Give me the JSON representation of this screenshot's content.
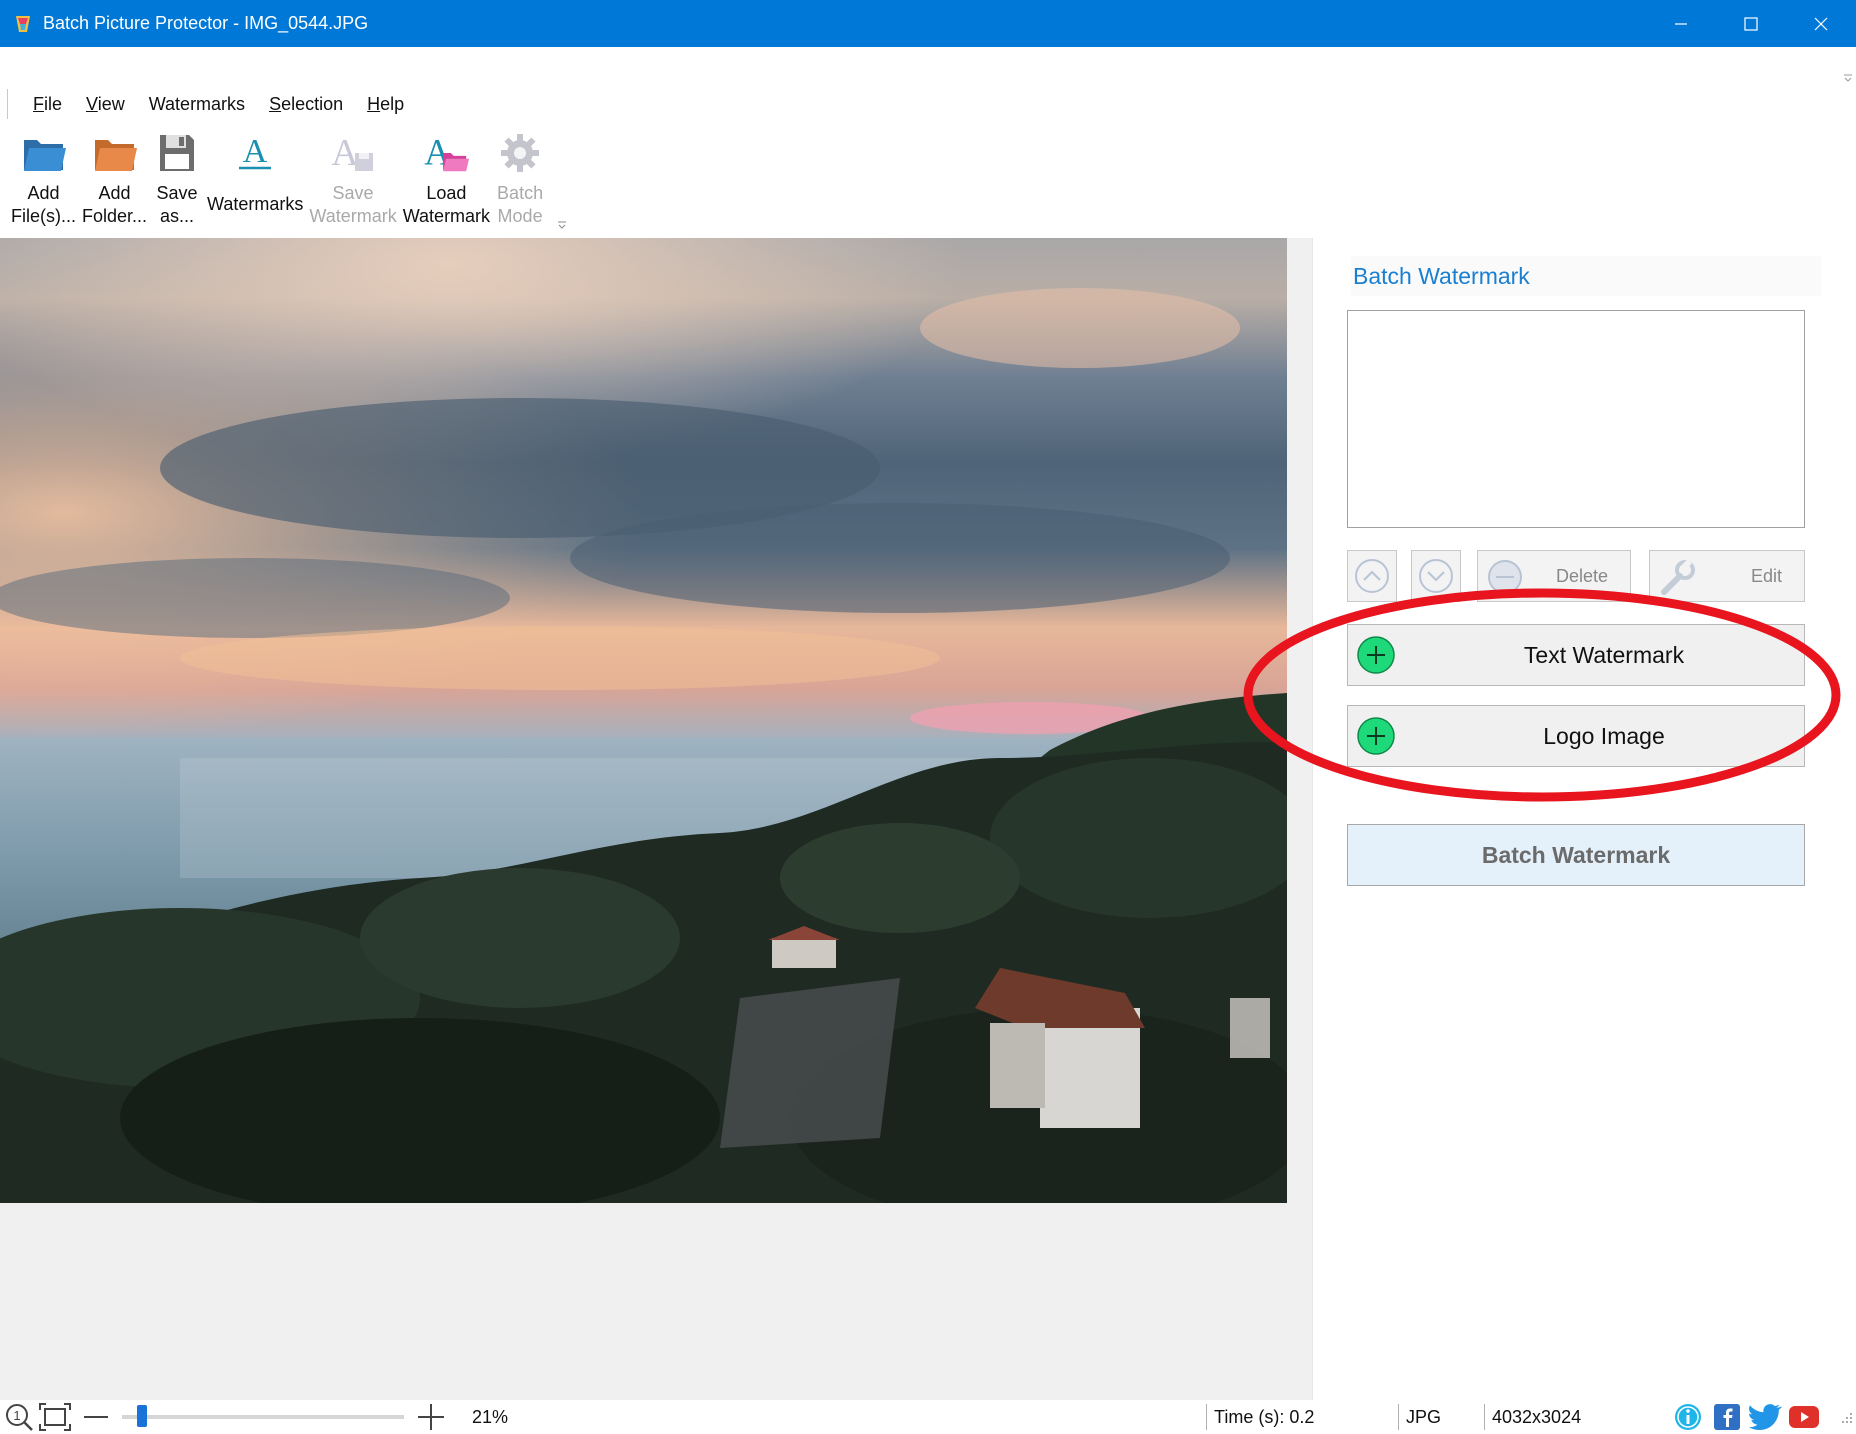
{
  "window": {
    "title": "Batch Picture Protector - IMG_0544.JPG",
    "accent_color": "#0078d7",
    "controls": [
      "minimize-icon",
      "maximize-icon",
      "close-icon"
    ]
  },
  "menu": {
    "file": {
      "underline": "F",
      "rest": "ile"
    },
    "view": {
      "underline": "V",
      "rest": "iew"
    },
    "watermarks": {
      "label": "Watermarks"
    },
    "selection": {
      "underline": "S",
      "rest": "election"
    },
    "help": {
      "underline": "H",
      "rest": "elp"
    }
  },
  "toolbar": {
    "add_files": {
      "line1": "Add",
      "line2": "File(s)...",
      "icon": "folder-blue-icon"
    },
    "add_folder": {
      "line1": "Add",
      "line2": "Folder...",
      "icon": "folder-orange-icon"
    },
    "save_as": {
      "line1": "Save",
      "line2": "as...",
      "icon": "floppy-disk-icon"
    },
    "watermarks": {
      "line1": "Watermarks",
      "icon": "text-watermark-icon"
    },
    "save_watermark": {
      "line1": "Save",
      "line2": "Watermark",
      "icon": "save-watermark-icon",
      "disabled": true
    },
    "load_watermark": {
      "line1": "Load",
      "line2": "Watermark",
      "icon": "load-watermark-icon"
    },
    "batch_mode": {
      "line1": "Batch",
      "line2": "Mode",
      "icon": "gear-icon",
      "disabled": true
    }
  },
  "panel": {
    "header": "Batch Watermark",
    "header_color": "#1a7fd0",
    "list_items": [],
    "delete_label": "Delete",
    "edit_label": "Edit",
    "text_watermark_label": "Text Watermark",
    "logo_image_label": "Logo Image",
    "batch_button_label": "Batch Watermark",
    "plus_color": "#1ed97a"
  },
  "annotation": {
    "color": "#e8141e",
    "shape": "ellipse"
  },
  "status": {
    "zoom": "21%",
    "zoom_fraction": 0.07,
    "time": "Time (s): 0.2",
    "format": "JPG",
    "dimensions": "4032x3024",
    "social_icons": [
      "info-icon",
      "facebook-icon",
      "twitter-icon",
      "youtube-icon"
    ]
  }
}
